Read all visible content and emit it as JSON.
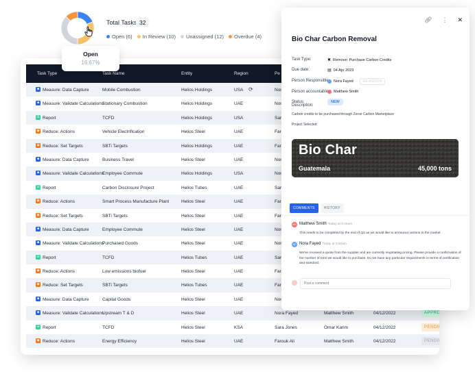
{
  "summary": {
    "title": "Total Tasks",
    "count": "32",
    "legend": [
      {
        "label": "Open (6)",
        "color": "#3b82f6",
        "value": 6
      },
      {
        "label": "In Review (10)",
        "color": "#f5c26b",
        "value": 10
      },
      {
        "label": "Unassigned (12)",
        "color": "#d1d5db",
        "value": 12
      },
      {
        "label": "Overdue (4)",
        "color": "#fb923c",
        "value": 4
      }
    ],
    "tooltip": {
      "label": "Open",
      "value": "16.67%"
    }
  },
  "table": {
    "columns": [
      "Task Type",
      "Task Name",
      "Entity",
      "Region",
      "Pe"
    ],
    "rows": [
      {
        "type": "Measure: Data Capture",
        "icon": "blue",
        "name": "Mobile Combustion",
        "entity": "Helios Holdings",
        "region": "USA",
        "person": "Nor",
        "refresh": true
      },
      {
        "type": "Measure: Validate Calculations",
        "icon": "blue",
        "name": "Stationary Combustion",
        "entity": "Helios Holdings",
        "region": "UAE",
        "person": "Nor"
      },
      {
        "type": "Report",
        "icon": "green",
        "name": "TCFD",
        "entity": "Helios Holdings",
        "region": "USA",
        "person": "Sar"
      },
      {
        "type": "Reduce: Actions",
        "icon": "orange",
        "name": "Vehicle Electrification",
        "entity": "Helios Steel",
        "region": "UAE",
        "person": "Far"
      },
      {
        "type": "Reduce: Set Targets",
        "icon": "orange",
        "name": "SBTi Targets",
        "entity": "Helios Holdings",
        "region": "UAE",
        "person": "Far"
      },
      {
        "type": "Measure: Data Capture",
        "icon": "blue",
        "name": "Business Travel",
        "entity": "Helios Steel",
        "region": "UAE",
        "person": "Nor"
      },
      {
        "type": "Measure: Validate Calculations",
        "icon": "blue",
        "name": "Employee Commute",
        "entity": "Helios Holdings",
        "region": "USA",
        "person": "Nor"
      },
      {
        "type": "Report",
        "icon": "green",
        "name": "Carbon Disclosure Project",
        "entity": "Helios Tubes",
        "region": "UAE",
        "person": "Sar"
      },
      {
        "type": "Reduce: Actions",
        "icon": "orange",
        "name": "Smart Process Manufacture Plant",
        "entity": "Helios Steel",
        "region": "UAE",
        "person": "Far"
      },
      {
        "type": "Reduce: Set Targets",
        "icon": "orange",
        "name": "SBTi Targets",
        "entity": "Helios Steel",
        "region": "UAE",
        "person": "Far"
      },
      {
        "type": "Measure: Data Capture",
        "icon": "blue",
        "name": "Employee Commute",
        "entity": "Helios Steel",
        "region": "UAE",
        "person": "Nor"
      },
      {
        "type": "Measure: Validate Calculations",
        "icon": "blue",
        "name": "Purchased Goods",
        "entity": "Helios Steel",
        "region": "UAE",
        "person": "Nor"
      },
      {
        "type": "Report",
        "icon": "green",
        "name": "TCFD",
        "entity": "Helios Tubes",
        "region": "UAE",
        "person": "Sar"
      },
      {
        "type": "Reduce: Actions",
        "icon": "orange",
        "name": "Low emissions biofuel",
        "entity": "Helios Steel",
        "region": "UAE",
        "person": "Far"
      },
      {
        "type": "Reduce: Set Targets",
        "icon": "orange",
        "name": "SBTi Targets",
        "entity": "Helios Tubes",
        "region": "UAE",
        "person": "Far"
      },
      {
        "type": "Measure: Data Capture",
        "icon": "blue",
        "name": "Capital Goods",
        "entity": "Helios Steel",
        "region": "UAE",
        "person": "Nor"
      },
      {
        "type": "Measure: Validate Calculations",
        "icon": "blue",
        "name": "Upstream T & D",
        "entity": "Helios Steel",
        "region": "UAE",
        "person": "Nora Fayed",
        "assignee": "Matthew Smith",
        "date": "04/12/2022",
        "status": "APPROVED",
        "status_style": "approved"
      },
      {
        "type": "Report",
        "icon": "green",
        "name": "TCFD",
        "entity": "Helios Steel",
        "region": "KSA",
        "person": "Sara Jones",
        "assignee": "Omar Karim",
        "date": "04/12/2022",
        "status": "PENDING",
        "status_style": "pending-o"
      },
      {
        "type": "Reduce: Actions",
        "icon": "orange",
        "name": "Energy Efficiency",
        "entity": "Helios Steel",
        "region": "UAE",
        "person": "Farouk Ali",
        "assignee": "Matthew Smith",
        "date": "04/12/2022",
        "status": "PENDING",
        "status_style": "pending-g"
      }
    ]
  },
  "panel": {
    "title": "Bio Char Carbon Removal",
    "fields": {
      "task_type_label": "Task Type:",
      "task_type_value": "Remove: Purchase Carbon Credits",
      "due_date_label": "Due date:",
      "due_date_value": "04 Apr 2023",
      "responsible_label": "Person Responsible:",
      "responsible_value": "Nora Fayed",
      "reassign_label": "RE-ASSIGN",
      "accountable_label": "Person accountable:",
      "accountable_value": "Matthew Smith",
      "status_label": "Status:",
      "status_value": "NEW",
      "description_label": "Description:"
    },
    "description": "Carbon credits to be purchased through Zeroe Carbon Marketplace",
    "project_label": "Project Selected:",
    "project": {
      "name": "Bio Char",
      "location": "Guatemala",
      "tons": "45,000 tons"
    },
    "tabs": {
      "comments": "COMMENTS",
      "history": "HISTORY"
    },
    "comments": [
      {
        "author": "Matthew Smith",
        "time": "Today at 9:45am",
        "avatar": "MS",
        "avatar_color": "#f87171",
        "text": "This needs to be completed by the end of Q2 as we would like to announce actions to the market"
      },
      {
        "author": "Nora Fayed",
        "time": "Today at 9:50am",
        "avatar": "NF",
        "avatar_color": "#60a5fa",
        "text": "We've received a quote from the supplier and are currently negotiating pricing. Please provide a confirmation of the number of tons we would like to purchase. Do we have any particular requirements in terms of certification and standard."
      }
    ],
    "comment_placeholder": "Post a comment"
  }
}
